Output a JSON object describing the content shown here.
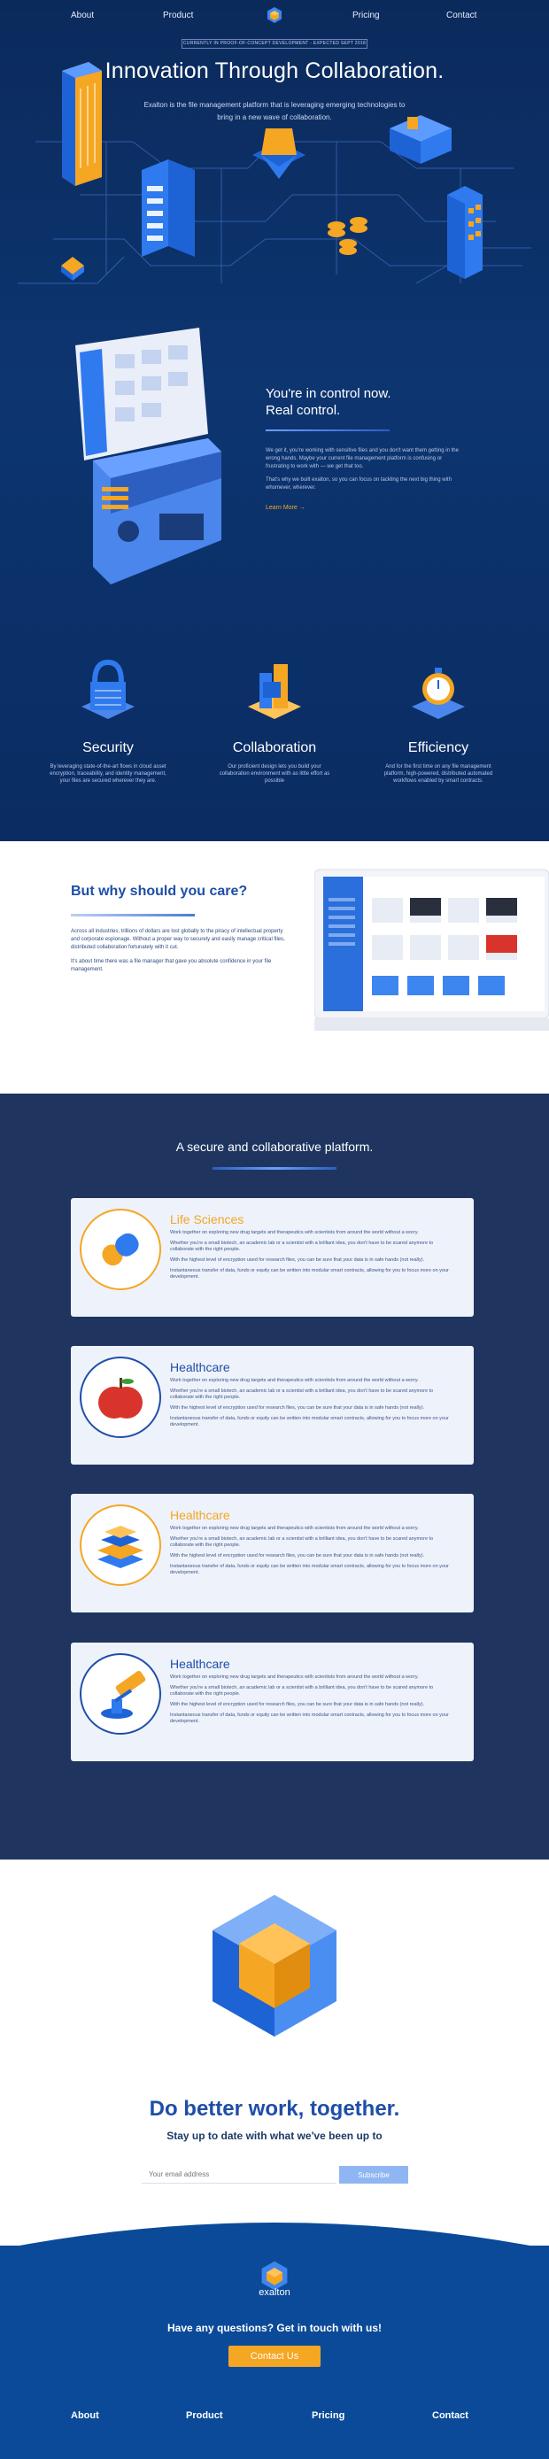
{
  "nav": {
    "about": "About",
    "product": "Product",
    "pricing": "Pricing",
    "contact": "Contact"
  },
  "hero": {
    "badge": "CURRENTLY IN PROOF-OF-CONCEPT DEVELOPMENT - EXPECTED SEPT 2018",
    "title": "Innovation Through Collaboration.",
    "subtitle": "Exalton is the file management platform that is leveraging emerging technologies to bring in a new wave of collaboration."
  },
  "control": {
    "title_line1": "You're in control now.",
    "title_line2": "Real control.",
    "p1": "We get it, you're working with sensitive files and you don't want them getting in the wrong hands. Maybe your current file management platform is confusing or frustrating to work with — we get that too.",
    "p2": "That's why we built exalton, so you can focus on tackling the next big thing with whomever, wherever.",
    "learn_more": "Learn More"
  },
  "features": [
    {
      "title": "Security",
      "text": "By leveraging state-of-the-art flows in cloud asset encryption, traceability, and identity management, your files are secured wherever they are.",
      "icon": "lock-icon"
    },
    {
      "title": "Collaboration",
      "text": "Our proficient design lets you build your collaboration environment with as little effort as possible",
      "icon": "collaboration-icon"
    },
    {
      "title": "Efficiency",
      "text": "And for the first time on any file management platform, high-powered, distributed automated workflows enabled by smart contracts.",
      "icon": "stopwatch-icon"
    }
  ],
  "care": {
    "title": "But why should you care?",
    "p1": "Across all industries, trillions of dollars are lost globally to the piracy of intellectual property and corporate espionage. Without a proper way to securely and easily manage critical files, distributed collaboration fortunately with it cut.",
    "p2": "It's about time there was a file manager that gave you absolute confidence in your file management."
  },
  "platform": {
    "title": "A secure and collaborative platform.",
    "cards": [
      {
        "title": "Life Sciences",
        "color": "#f5a623",
        "icon": "pill-icon"
      },
      {
        "title": "Healthcare",
        "color": "#1e4ea8",
        "icon": "apple-icon"
      },
      {
        "title": "Healthcare",
        "color": "#f5a623",
        "icon": "books-icon"
      },
      {
        "title": "Healthcare",
        "color": "#1e4ea8",
        "icon": "gavel-icon"
      }
    ],
    "p1": "Work together on exploring new drug targets and therapeutics with scientists from around the world without a worry.",
    "p2": "Whether you're a small biotech, an academic lab or a scientist with a brilliant idea, you don't have to be scared anymore to collaborate with the right people.",
    "p3": "With the highest level of encryption used for research files, you can be sure that your data is in safe hands (not really).",
    "p4": "Instantaneous transfer of data, funds or equity can be written into modular smart contracts, allowing for you to focus more on your development."
  },
  "bottom": {
    "title": "Do better work, together.",
    "subtitle": "Stay up to date with what we've been up to",
    "email_placeholder": "Your email address",
    "subscribe": "Subscribe"
  },
  "footer": {
    "brand": "exalton",
    "question": "Have any questions? Get in touch with us!",
    "contact_button": "Contact Us",
    "about": "About",
    "product": "Product",
    "pricing": "Pricing",
    "contact": "Contact"
  }
}
